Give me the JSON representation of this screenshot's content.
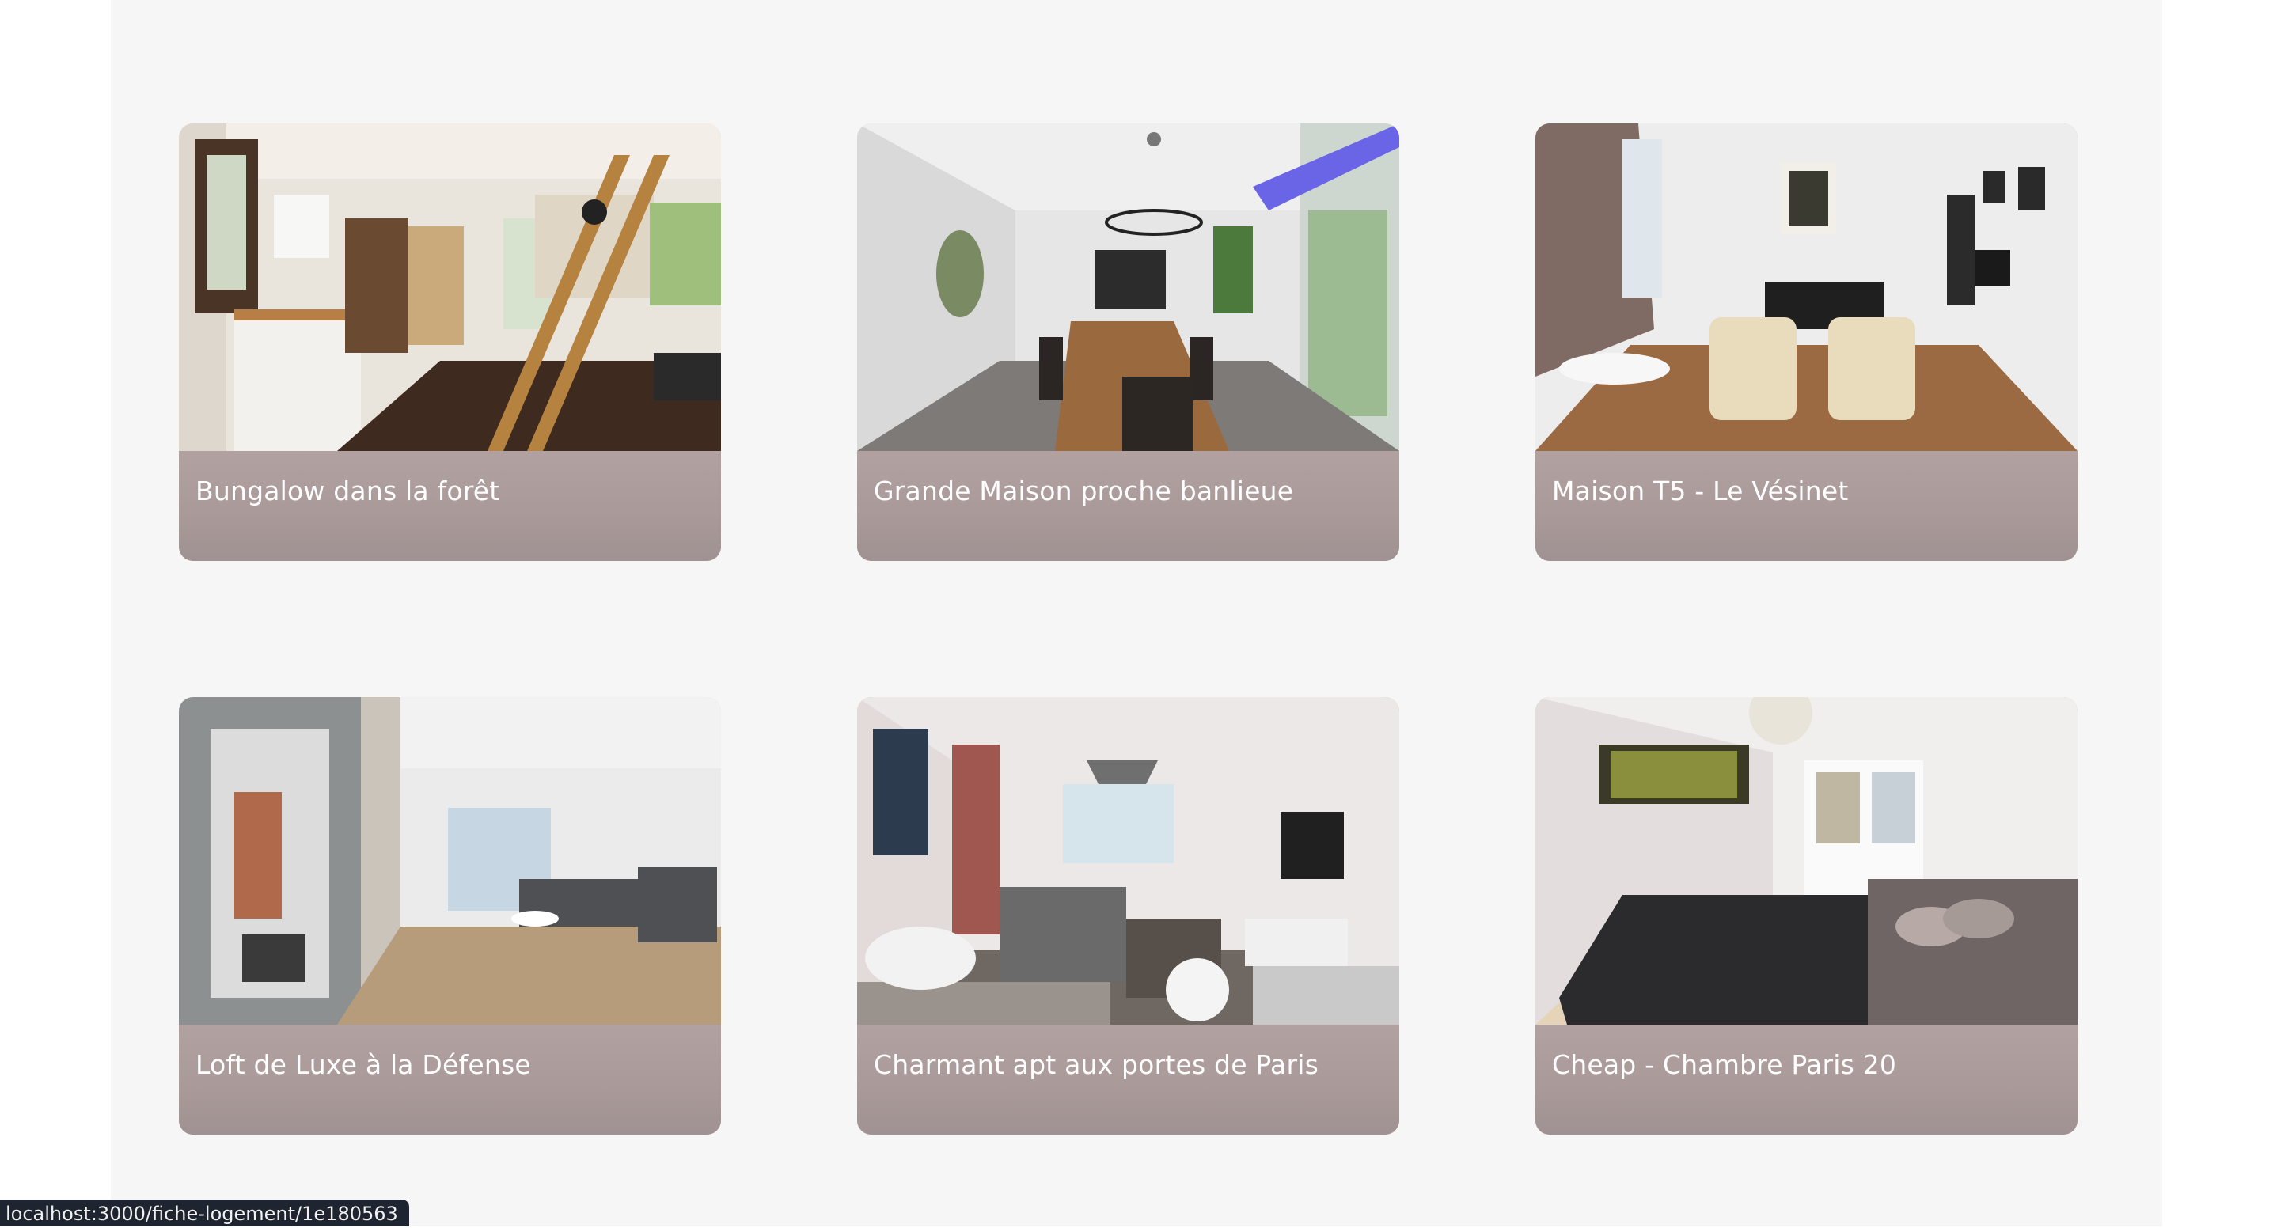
{
  "listings": [
    {
      "title": "Bungalow dans la forêt",
      "photo_icon": "bungalow-interior-photo"
    },
    {
      "title": "Grande Maison proche banlieue",
      "photo_icon": "dining-room-photo"
    },
    {
      "title": "Maison T5 - Le Vésinet",
      "photo_icon": "bedroom-lounge-photo"
    },
    {
      "title": "Loft de Luxe à la Défense",
      "photo_icon": "loft-living-room-photo"
    },
    {
      "title": "Charmant apt aux portes de Paris",
      "photo_icon": "apartment-living-room-photo"
    },
    {
      "title": "Cheap - Chambre Paris 20",
      "photo_icon": "bedroom-photo"
    }
  ],
  "status_bar": {
    "url": "localhost:3000/fiche-logement/1e180563"
  },
  "colors": {
    "card_footer": "#ac9c9c",
    "page_background": "#f6f6f6",
    "status_bar": "#1e2530"
  }
}
